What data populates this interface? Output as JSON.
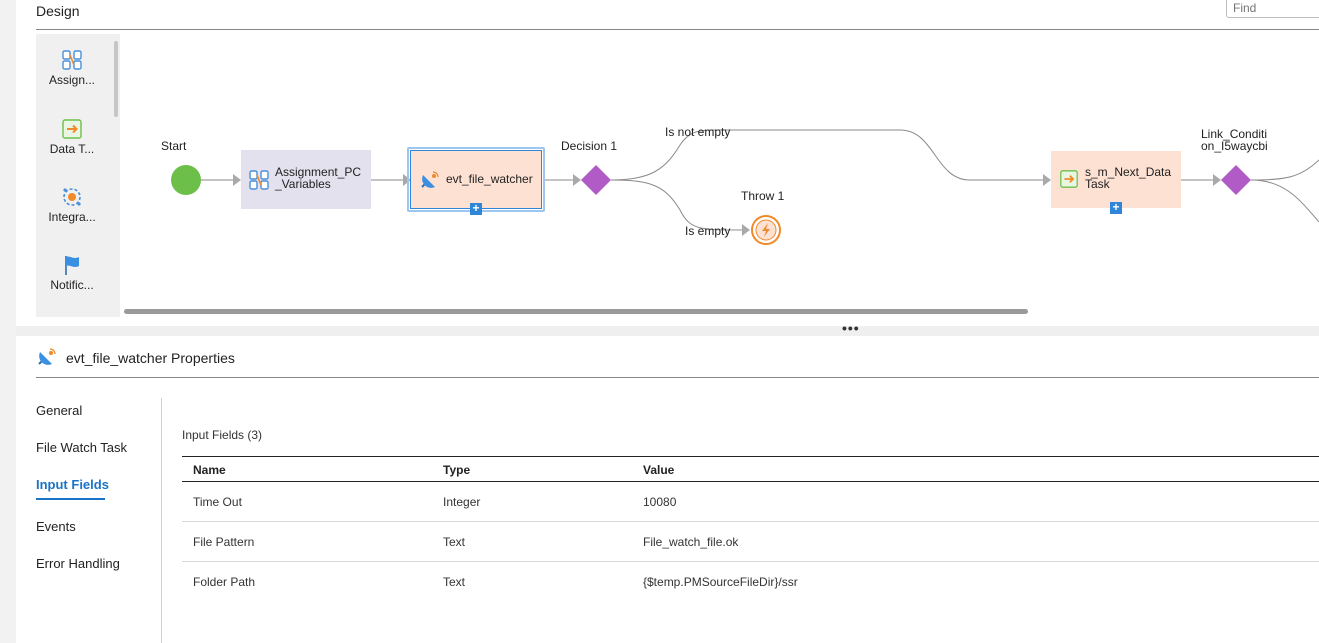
{
  "design": {
    "title": "Design",
    "find_placeholder": "Find"
  },
  "palette": {
    "items": [
      {
        "label": "Assign...",
        "icon": "assignment-icon"
      },
      {
        "label": "Data T...",
        "icon": "data-task-icon"
      },
      {
        "label": "Integra...",
        "icon": "integration-icon"
      },
      {
        "label": "Notific...",
        "icon": "notification-flag-icon"
      }
    ]
  },
  "canvas": {
    "start_label": "Start",
    "assignment_label": "Assignment_PC _Variables",
    "file_watcher_label": "evt_file_watcher",
    "decision_label": "Decision 1",
    "is_not_empty_label": "Is not empty",
    "is_empty_label": "Is empty",
    "throw_label": "Throw 1",
    "next_task_label": "s_m_Next_Data Task",
    "link_condition_label": "Link_Conditi on_I5waycbi",
    "colors": {
      "start": "#6cc04a",
      "decision": "#b15cc6",
      "throw": "#f08a2a",
      "assignment_bg": "#e4e1ee",
      "task_bg": "#fde1d3",
      "selection": "#2f86d8"
    }
  },
  "splitter": {
    "dots": "•••"
  },
  "properties": {
    "title": "evt_file_watcher Properties",
    "nav": [
      {
        "label": "General",
        "active": false
      },
      {
        "label": "File Watch Task",
        "active": false
      },
      {
        "label": "Input Fields",
        "active": true
      },
      {
        "label": "Events",
        "active": false
      },
      {
        "label": "Error Handling",
        "active": false
      }
    ],
    "input_fields": {
      "caption": "Input Fields (3)",
      "columns": [
        "Name",
        "Type",
        "Value"
      ],
      "rows": [
        {
          "name": "Time Out",
          "type": "Integer",
          "value": "10080"
        },
        {
          "name": "File Pattern",
          "type": "Text",
          "value": "File_watch_file.ok"
        },
        {
          "name": "Folder Path",
          "type": "Text",
          "value": "{$temp.PMSourceFileDir}/ssr"
        }
      ]
    }
  }
}
